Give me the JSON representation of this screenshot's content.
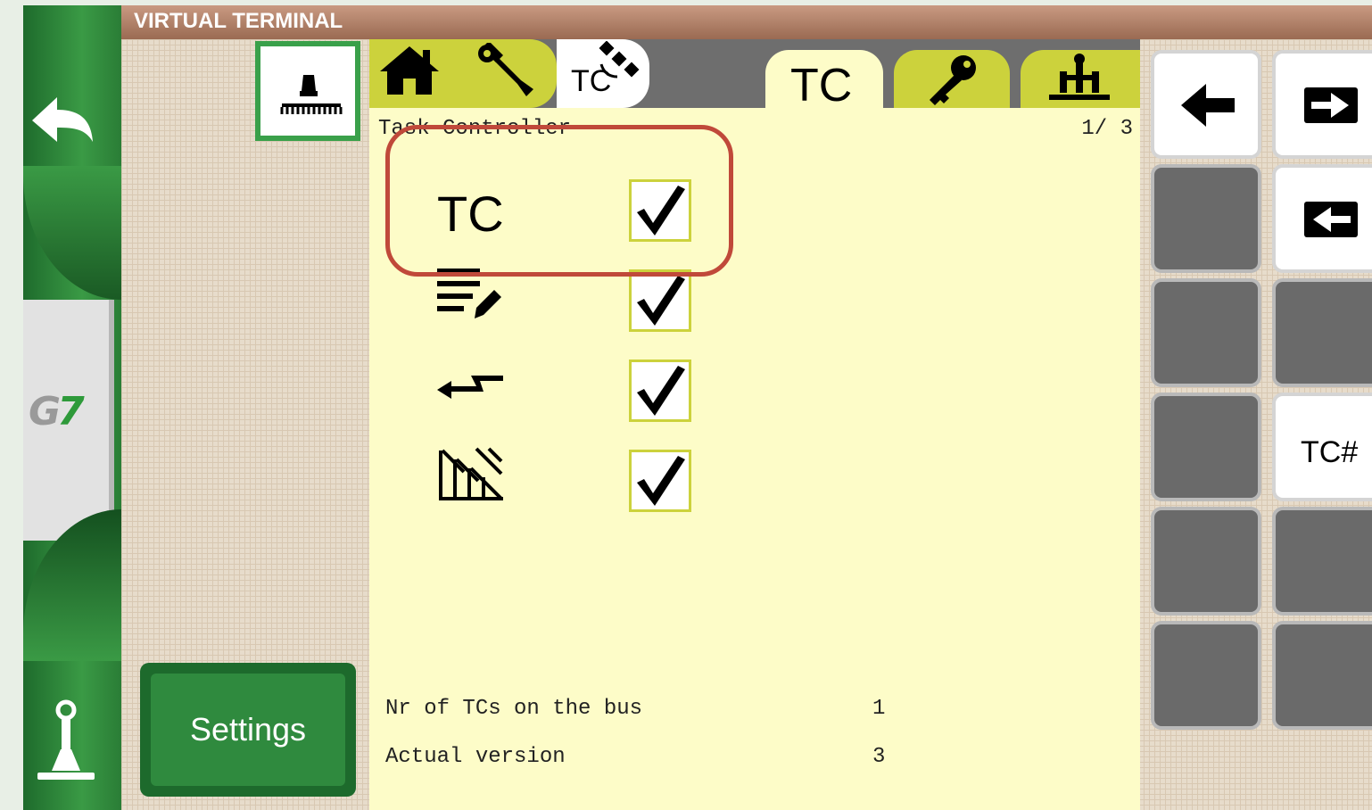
{
  "title": "VIRTUAL TERMINAL",
  "sidebar": {
    "back_icon": "back-arrow-icon",
    "logo_text": "G7",
    "joystick_icon": "joystick-icon"
  },
  "settings_label": "Settings",
  "tabs": {
    "home_icon": "home-icon",
    "wrench_icon": "wrench-icon",
    "tc_satellite_label": "TC",
    "active_tab_label": "TC",
    "key_icon": "key-icon",
    "implement_icon": "implement-icon"
  },
  "panel": {
    "header": "Task Controller",
    "page": "1/ 3",
    "options": [
      {
        "label": "TC",
        "icon": "tc-text",
        "checked": true
      },
      {
        "label": "",
        "icon": "list-edit-icon",
        "checked": true
      },
      {
        "label": "",
        "icon": "swap-arrows-icon",
        "checked": true
      },
      {
        "label": "",
        "icon": "section-control-icon",
        "checked": true
      }
    ],
    "info": [
      {
        "label": "Nr of TCs on the bus",
        "value": "1"
      },
      {
        "label": "Actual version",
        "value": "3"
      }
    ]
  },
  "softkeys": {
    "arrow_left_icon": "arrow-left-icon",
    "enter_right_icon": "box-arrow-right-icon",
    "enter_left_icon": "box-arrow-left-icon",
    "tc_hash_label": "TC#"
  },
  "colors": {
    "sidebar_green": "#2f8a3e",
    "tab_yellow": "#ccd23c",
    "panel_yellow": "#fdfcc8",
    "highlight_red": "#c0493a",
    "title_brown": "#9a6a52"
  }
}
